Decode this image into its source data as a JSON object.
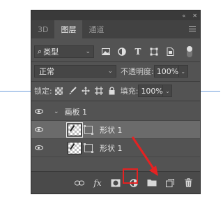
{
  "titlebar": {
    "collapse_glyph": "«",
    "close_glyph": "✕"
  },
  "tabs": [
    {
      "label": "3D",
      "active": false
    },
    {
      "label": "图层",
      "active": true
    },
    {
      "label": "通道",
      "active": false
    }
  ],
  "filter": {
    "search_glyph": "⌕",
    "kind_label": "类型",
    "chevron": "⌄",
    "icons": [
      "image-filter-icon",
      "adjustment-filter-icon",
      "type-filter-icon",
      "shape-filter-icon",
      "smart-object-filter-icon"
    ],
    "type_glyph": "T",
    "toggle_state": "on"
  },
  "blend": {
    "mode": "正常",
    "chevron": "⌄",
    "opacity_label": "不透明度:",
    "opacity_value": "100%",
    "dd_glyph": "⌄"
  },
  "lock": {
    "label": "锁定:",
    "fill_label": "填充:",
    "fill_value": "100%",
    "dd_glyph": "⌄",
    "icons": [
      "lock-transparent-icon",
      "lock-brush-icon",
      "lock-position-icon",
      "lock-artboard-icon",
      "lock-all-icon"
    ]
  },
  "layers": [
    {
      "type": "group",
      "name": "画板 1",
      "chevron": "⌄",
      "visible": true,
      "selected": false
    },
    {
      "type": "shape",
      "name": "形状 1",
      "visible": true,
      "selected": true
    },
    {
      "type": "shape",
      "name": "形状 1",
      "visible": true,
      "selected": false
    }
  ],
  "bottom_bar": {
    "fx_label": "fx",
    "icons": [
      "link-layers-icon",
      "layer-style-icon",
      "add-mask-icon",
      "new-adjustment-icon",
      "new-group-icon",
      "new-layer-icon",
      "delete-layer-icon"
    ]
  },
  "colors": {
    "panel_bg": "#535353",
    "selected_layer": "#6b6b6b",
    "annotation_red": "#e52222"
  }
}
